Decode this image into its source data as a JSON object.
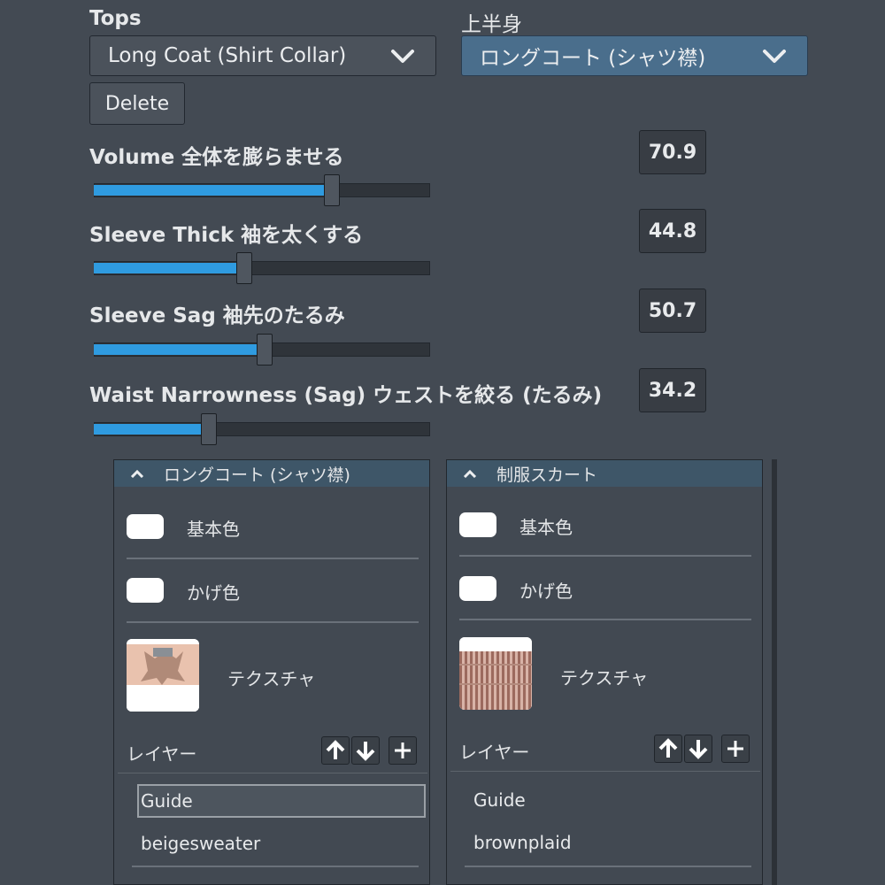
{
  "tops_label": "Tops",
  "tops_label_jp": "上半身",
  "tops_dropdown": "Long Coat (Shirt Collar)",
  "tops_dropdown_jp": "ロングコート (シャツ襟)",
  "delete_label": "Delete",
  "sliders": [
    {
      "label": "Volume  全体を膨らませる",
      "value": "70.9",
      "fraction": 0.709
    },
    {
      "label": "Sleeve Thick 袖を太くする",
      "value": "44.8",
      "fraction": 0.448
    },
    {
      "label": "Sleeve Sag  袖先のたるみ",
      "value": "50.7",
      "fraction": 0.507
    },
    {
      "label": "Waist Narrowness (Sag) ウェストを絞る (たるみ)",
      "value": "34.2",
      "fraction": 0.342
    }
  ],
  "panels": [
    {
      "title": "ロングコート (シャツ襟)",
      "base_color_label": "基本色",
      "shadow_color_label": "かげ色",
      "texture_label": "テクスチャ",
      "layer_label": "レイヤー",
      "layers": [
        "Guide",
        "beigesweater"
      ],
      "selected_layer": "Guide"
    },
    {
      "title": "制服スカート",
      "base_color_label": "基本色",
      "shadow_color_label": "かげ色",
      "texture_label": "テクスチャ",
      "layer_label": "レイヤー",
      "layers": [
        "Guide",
        "brownplaid"
      ]
    }
  ],
  "colors": {
    "background": "#434a53",
    "accent_fill": "#2f9be0",
    "active_dropdown": "#4a6e8c",
    "panel_header": "#3e5668",
    "swatch": "#ffffff"
  },
  "icons": [
    "chevron-down-icon",
    "caret-up-icon",
    "arrow-up-icon",
    "arrow-down-icon",
    "plus-icon"
  ]
}
